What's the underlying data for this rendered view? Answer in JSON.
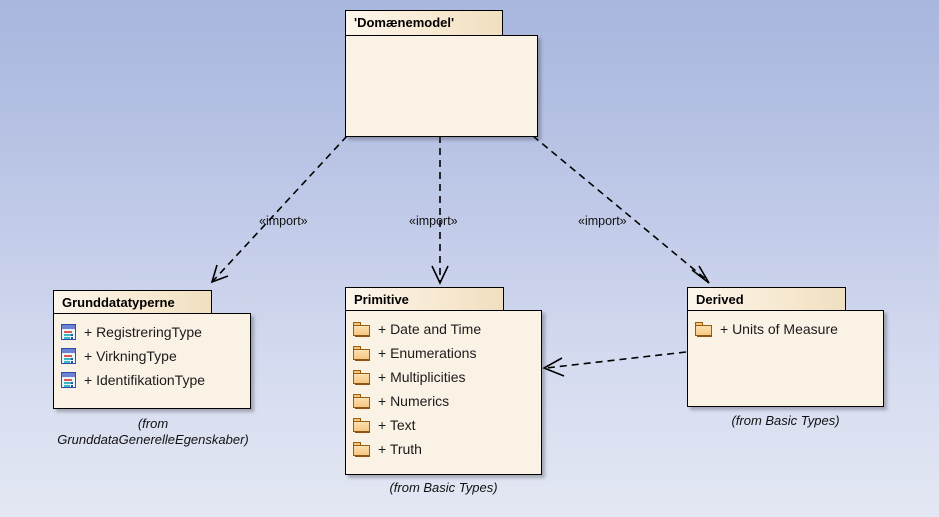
{
  "diagram": {
    "type": "uml-package-diagram",
    "background_top_color": "#a9b6de",
    "background_bottom_color": "#e4e8f4",
    "package_header_color": "#f8ead3",
    "package_body_color": "#fbf2e6",
    "border_color": "#000000"
  },
  "packages": [
    {
      "id": "domaenemodel",
      "name": "'Domænemodel'",
      "caption": "",
      "items": []
    },
    {
      "id": "grunddatatyperne",
      "name": "Grunddatatyperne",
      "caption": "(from GrunddataGenerelleEgenskaber)",
      "caption_line1": "(from",
      "caption_line2": "GrunddataGenerelleEgenskaber)",
      "items": [
        {
          "visibility": "+",
          "label": "+ RegistreringType",
          "icon": "class-icon"
        },
        {
          "visibility": "+",
          "label": "+ VirkningType",
          "icon": "class-icon"
        },
        {
          "visibility": "+",
          "label": "+ IdentifikationType",
          "icon": "class-icon"
        }
      ]
    },
    {
      "id": "primitive",
      "name": "Primitive",
      "caption": "(from Basic Types)",
      "items": [
        {
          "visibility": "+",
          "label": "+ Date and Time",
          "icon": "package-folder-icon"
        },
        {
          "visibility": "+",
          "label": "+ Enumerations",
          "icon": "package-folder-icon"
        },
        {
          "visibility": "+",
          "label": "+ Multiplicities",
          "icon": "package-folder-icon"
        },
        {
          "visibility": "+",
          "label": "+ Numerics",
          "icon": "package-folder-icon"
        },
        {
          "visibility": "+",
          "label": "+ Text",
          "icon": "package-folder-icon"
        },
        {
          "visibility": "+",
          "label": "+ Truth",
          "icon": "package-folder-icon"
        }
      ]
    },
    {
      "id": "derived",
      "name": "Derived",
      "caption": "(from Basic Types)",
      "items": [
        {
          "visibility": "+",
          "label": "+ Units of Measure",
          "icon": "package-folder-icon"
        }
      ]
    }
  ],
  "relationships": [
    {
      "id": "import-left",
      "label": "«import»",
      "from": "domaenemodel",
      "to": "grunddatatyperne",
      "style": "dashed",
      "arrow": "open"
    },
    {
      "id": "import-middle",
      "label": "«import»",
      "from": "domaenemodel",
      "to": "primitive",
      "style": "dashed",
      "arrow": "open"
    },
    {
      "id": "import-right",
      "label": "«import»",
      "from": "domaenemodel",
      "to": "derived",
      "style": "dashed",
      "arrow": "open"
    },
    {
      "id": "dependency-derived-primitive",
      "label": "",
      "from": "derived",
      "to": "primitive",
      "style": "dashed",
      "arrow": "open"
    }
  ]
}
